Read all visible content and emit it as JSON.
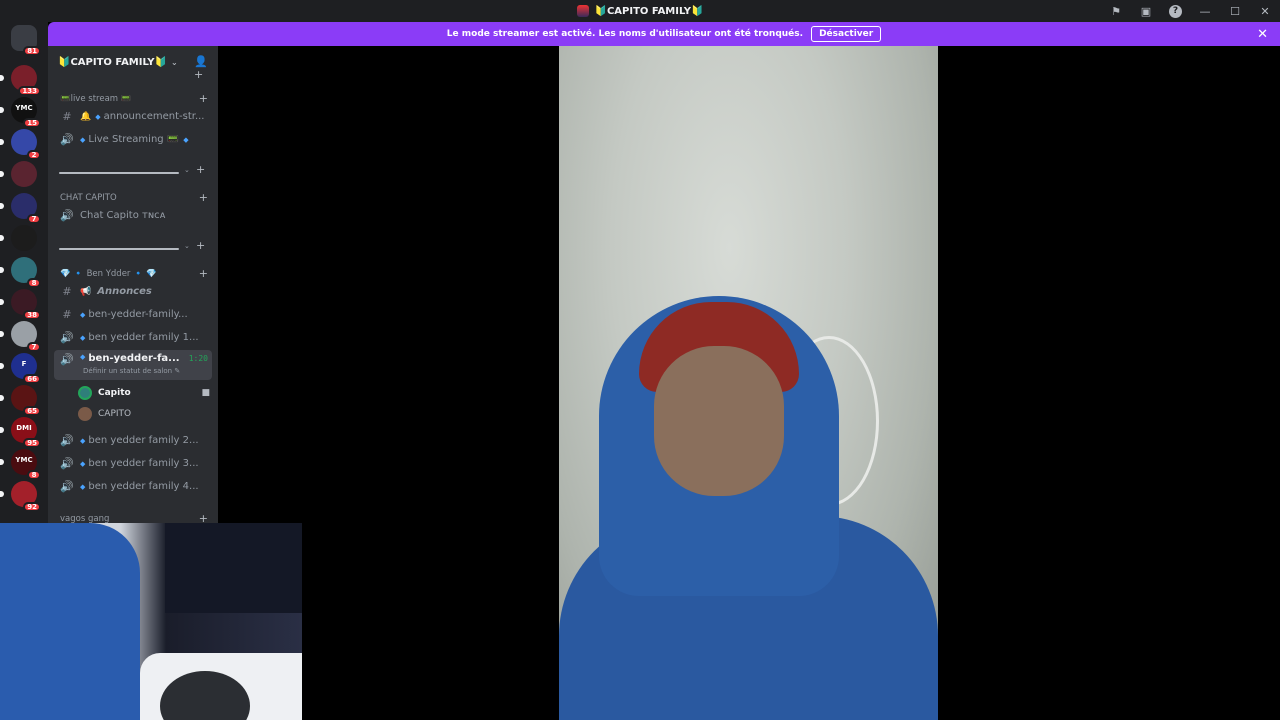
{
  "window": {
    "title": "🔰CAPITO FAMILY🔰"
  },
  "banner": {
    "text": "Le mode streamer est activé. Les noms d'utilisateur ont été tronqués.",
    "button": "Désactiver"
  },
  "servers": [
    {
      "badge": "81",
      "color": "#3a3d44"
    },
    {
      "badge": "133",
      "color": "#7a1f2a"
    },
    {
      "badge": "15",
      "tag": "YMC",
      "color": "#111111"
    },
    {
      "badge": "2",
      "color": "#3548a8"
    },
    {
      "badge": "",
      "color": "#5a2430"
    },
    {
      "badge": "7",
      "color": "#2a2d6a"
    },
    {
      "badge": "",
      "color": "#1c1c1c"
    },
    {
      "badge": "8",
      "color": "#2f6f7a"
    },
    {
      "badge": "38",
      "color": "#3b1a24"
    },
    {
      "badge": "7",
      "color": "#9aa0a6"
    },
    {
      "badge": "66",
      "tag": "F",
      "color": "#1f2f8f"
    },
    {
      "badge": "65",
      "color": "#5a1414"
    },
    {
      "badge": "95",
      "tag": "DMI",
      "color": "#8a0f18"
    },
    {
      "badge": "8",
      "tag": "YMC",
      "color": "#4a0c10"
    },
    {
      "badge": "92",
      "color": "#a3202a"
    }
  ],
  "sidebar": {
    "guild_name": "🔰CAPITO FAMILY🔰",
    "categories": {
      "live": "📟live stream 📟",
      "chat": "CHAT CAPITO",
      "ben": "💎 🔹 Ben Ydder 🔹 💎",
      "vagos": "vagos gang"
    },
    "channels": {
      "announcement": "announcement-str...",
      "live_streaming": "Live Streaming 📟",
      "chat_capito": "Chat Capito ᴛɴᴄᴀ",
      "annonces": "Annonces",
      "family_text": "ben-yedder-family...",
      "family1": "ben yedder family 1...",
      "active": "ben-yedder-fa...",
      "active_status": "Définir un statut de salon",
      "active_timer": "1:20",
      "family2": "ben yedder family 2...",
      "family3": "ben yedder family 3...",
      "family4": "ben yedder family 4..."
    },
    "voice_users": [
      {
        "name": "Capito",
        "color": "#2f7f7a"
      },
      {
        "name": "CAPITO",
        "color": "#7a5a48"
      }
    ]
  }
}
